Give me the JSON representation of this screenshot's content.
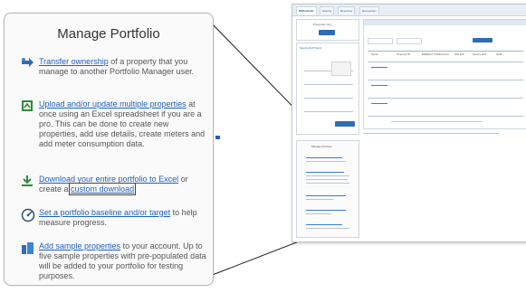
{
  "panel": {
    "title": "Manage Portfolio",
    "items": [
      {
        "icon": "transfer-ownership-icon",
        "link": "Transfer ownership",
        "text": " of a property that you manage to another Portfolio Manager user."
      },
      {
        "icon": "spreadsheet-upload-icon",
        "link": "Upload and/or update multiple properties",
        "text": " at once using an Excel spreadsheet if you are a pro. This can be done to create new properties, add use details, create meters and add meter consumption data."
      },
      {
        "icon": "download-icon",
        "link": "Download your entire portfolio to Excel",
        "text": " or create a ",
        "link2": "custom download"
      },
      {
        "icon": "target-gauge-icon",
        "link": "Set a portfolio baseline and/or target",
        "text": " to help measure progress."
      },
      {
        "icon": "buildings-icon",
        "link": "Add sample properties",
        "text": " to your account. Up to five sample properties with pre-populated data will be added to your portfolio for testing purposes."
      }
    ]
  },
  "thumbnail": {
    "tabs": [
      "MyPortfolio",
      "Sharing",
      "Reporting",
      "Recognition"
    ],
    "side_box_title": "Properties (21)",
    "score_title": "Source EUI Trend",
    "manage_title": "Manage Portfolio",
    "table_headers": [
      "Name",
      "Property ID",
      "ENERGY STAR Score",
      "Site EUI",
      "Source EUI",
      "GHG"
    ]
  },
  "colors": {
    "link": "#1f5fbf",
    "panel_border": "#b9b9b9",
    "button": "#2e6db4"
  }
}
